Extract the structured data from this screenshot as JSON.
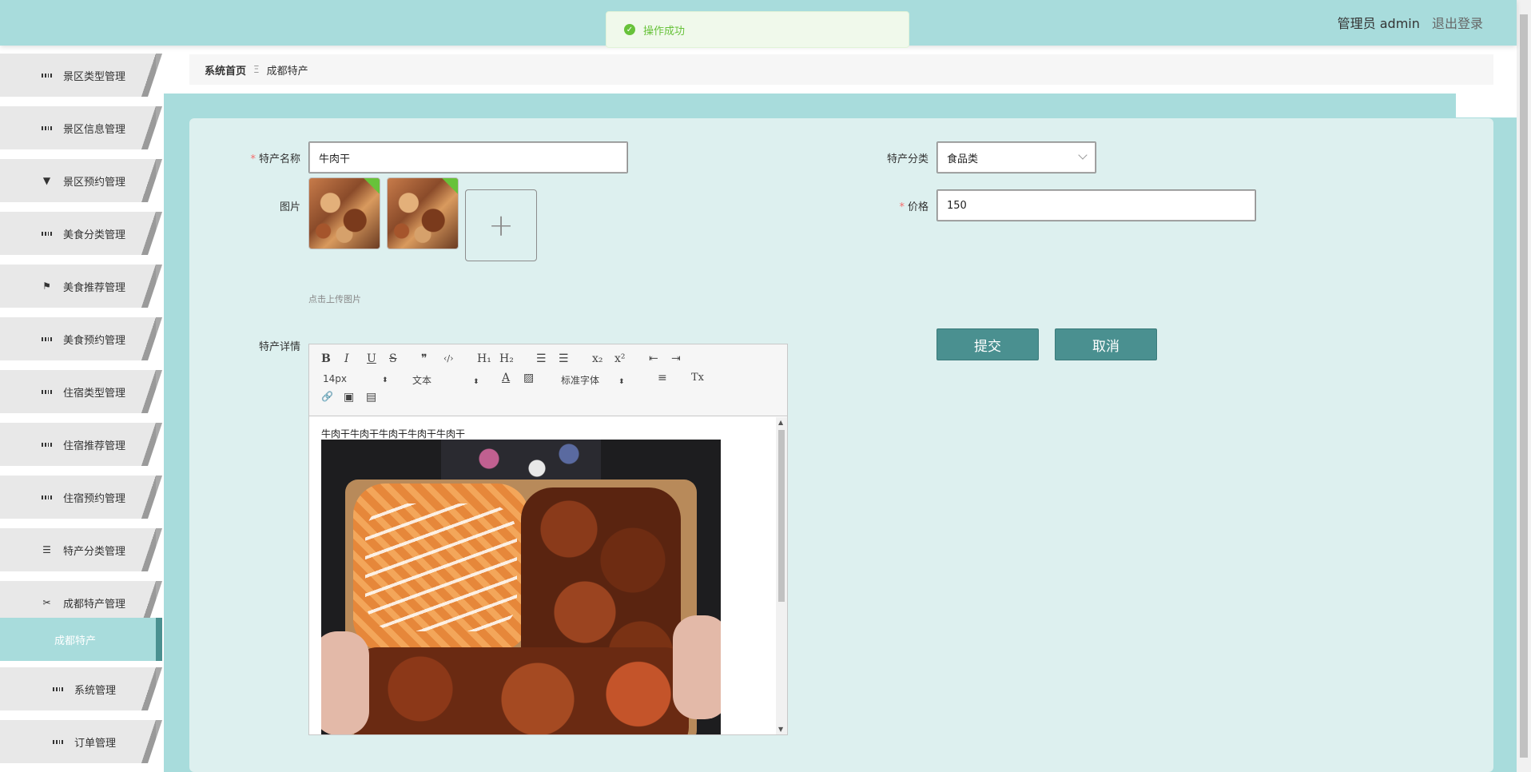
{
  "header": {
    "user_label": "管理员 admin",
    "logout_label": "退出登录"
  },
  "toast": {
    "message": "操作成功",
    "color": "#67c23a"
  },
  "sidebar": {
    "items": [
      {
        "label": "景区类型管理",
        "icon": "grid-icon"
      },
      {
        "label": "景区信息管理",
        "icon": "grid-icon"
      },
      {
        "label": "景区预约管理",
        "icon": "stamp-icon"
      },
      {
        "label": "美食分类管理",
        "icon": "grid-icon"
      },
      {
        "label": "美食推荐管理",
        "icon": "flag-icon"
      },
      {
        "label": "美食预约管理",
        "icon": "grid-icon"
      },
      {
        "label": "住宿类型管理",
        "icon": "grid-icon"
      },
      {
        "label": "住宿推荐管理",
        "icon": "grid-icon"
      },
      {
        "label": "住宿预约管理",
        "icon": "grid-icon"
      },
      {
        "label": "特产分类管理",
        "icon": "list-icon"
      },
      {
        "label": "成都特产管理",
        "icon": "ticket-icon"
      }
    ],
    "active_sub": "成都特产",
    "bottom_items": [
      {
        "label": "系统管理",
        "icon": "grid-icon"
      },
      {
        "label": "订单管理",
        "icon": "grid-icon"
      }
    ],
    "accent": "#a8dcdc"
  },
  "breadcrumb": {
    "home": "系统首页",
    "separator": "Ξ",
    "current": "成都特产"
  },
  "form": {
    "name_label": "特产名称",
    "name_value": "牛肉干",
    "category_label": "特产分类",
    "category_value": "食品类",
    "image_label": "图片",
    "price_label": "价格",
    "price_value": "150",
    "upload_tip": "点击上传图片",
    "upload_plus": "+",
    "detail_label": "特产详情",
    "required_mark": "*"
  },
  "editor": {
    "font_size": "14px",
    "text_style": "文本",
    "font_family": "标准字体",
    "content_text": "牛肉干牛肉干牛肉干牛肉干牛肉干",
    "toolbar": {
      "bold": "B",
      "italic": "I",
      "underline": "U",
      "strike": "S",
      "quote": "❞",
      "code": "‹/›",
      "h1": "H₁",
      "h2": "H₂",
      "ol": "☰",
      "ul": "☰",
      "sub": "x₂",
      "sup": "x²",
      "outdent": "⇤",
      "indent": "⇥",
      "color": "A",
      "background": "▨",
      "align": "≡",
      "clean": "Tx",
      "link": "🔗",
      "image": "▣",
      "video": "▤",
      "updown": "⬍"
    }
  },
  "buttons": {
    "submit": "提交",
    "cancel": "取消",
    "color": "#4a9090"
  }
}
